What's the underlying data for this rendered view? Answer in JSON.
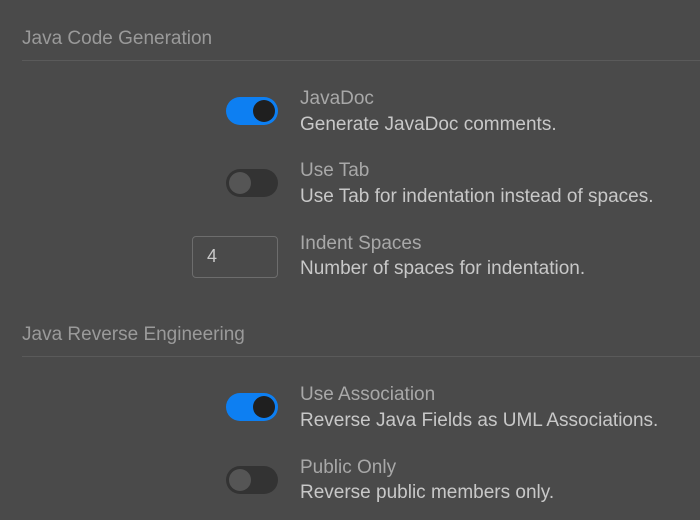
{
  "sections": {
    "codegen": {
      "header": "Java Code Generation",
      "javadoc": {
        "title": "JavaDoc",
        "desc": "Generate JavaDoc comments.",
        "value": true
      },
      "usetab": {
        "title": "Use Tab",
        "desc": "Use Tab for indentation instead of spaces.",
        "value": false
      },
      "indent": {
        "title": "Indent Spaces",
        "desc": "Number of spaces for indentation.",
        "value": "4"
      }
    },
    "reverse": {
      "header": "Java Reverse Engineering",
      "assoc": {
        "title": "Use Association",
        "desc": "Reverse Java Fields as UML Associations.",
        "value": true
      },
      "publiconly": {
        "title": "Public Only",
        "desc": "Reverse public members only.",
        "value": false
      }
    }
  }
}
